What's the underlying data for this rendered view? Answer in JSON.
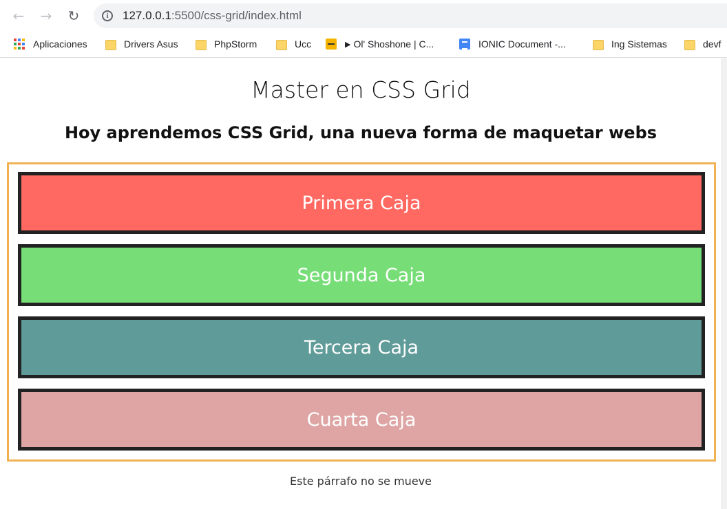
{
  "browser": {
    "url_host": "127.0.0.1",
    "url_rest": ":5500/css-grid/index.html",
    "bookmarks": [
      {
        "label": "Aplicaciones",
        "icon": "apps-icon"
      },
      {
        "label": "Drivers Asus",
        "icon": "folder-icon"
      },
      {
        "label": "PhpStorm",
        "icon": "folder-icon"
      },
      {
        "label": "Ucc",
        "icon": "folder-icon"
      },
      {
        "label": "Ol' Shoshone | C...",
        "icon": "audio-icon"
      },
      {
        "label": "IONIC Document -...",
        "icon": "doc-icon"
      },
      {
        "label": "Ing Sistemas",
        "icon": "folder-icon"
      },
      {
        "label": "devf",
        "icon": "folder-icon"
      }
    ]
  },
  "page": {
    "title": "Master en CSS Grid",
    "subtitle": "Hoy aprendemos CSS Grid, una nueva forma de maquetar webs",
    "boxes": [
      {
        "label": "Primera Caja",
        "color": "#ff6961"
      },
      {
        "label": "Segunda Caja",
        "color": "#77dd77"
      },
      {
        "label": "Tercera Caja",
        "color": "#5f9b98"
      },
      {
        "label": "Cuarta Caja",
        "color": "#dea5a4"
      }
    ],
    "footer": "Este párrafo no se mueve",
    "container_border_color": "#f0b252"
  }
}
